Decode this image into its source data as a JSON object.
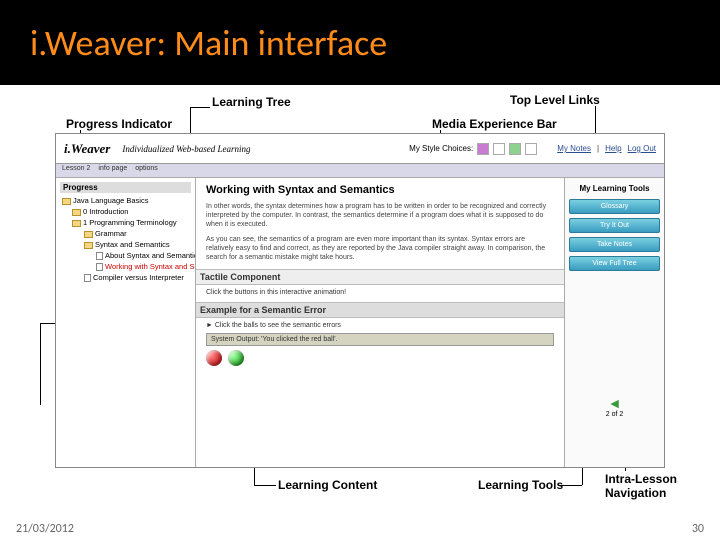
{
  "slide": {
    "title": "i.Weaver: Main interface",
    "date": "21/03/2012",
    "page": "30"
  },
  "callouts": {
    "progress": "Progress Indicator",
    "tree": "Learning Tree",
    "toplinks": "Top Level Links",
    "media": "Media Experience Bar",
    "tactile": "Tactile Component",
    "content": "Learning Content",
    "tools": "Learning Tools",
    "intranav": "Intra-Lesson Navigation"
  },
  "ss": {
    "logo": "i.Weaver",
    "tagline": "Individualized Web-based Learning",
    "styles_label": "My Style Choices:",
    "toplinks": {
      "notes": "My Notes",
      "help": "Help",
      "logout": "Log Out"
    },
    "nav": {
      "a": "Lesson 2",
      "b": "info page",
      "c": "options"
    },
    "tree": {
      "hdr": "Progress",
      "root": "Java Language Basics",
      "intro": "0 Introduction",
      "term": "1 Programming Terminology",
      "gram": "Grammar",
      "synsem": "Syntax and Semantics",
      "about": "About Syntax and Semantics",
      "work": "Working with Syntax and Semantics",
      "compint": "Compiler versus Interpreter"
    },
    "main": {
      "h1": "Working with Syntax and Semantics",
      "p1": "In other words, the syntax determines how a program has to be written in order to be recognized and correctly interpreted by the computer. In contrast, the semantics determine if a program does what it is supposed to do when it is executed.",
      "p2": "As you can see, the semantics of a program are even more important than its syntax. Syntax errors are relatively easy to find and correct, as they are reported by the Java compiler straight away. In comparison, the search for a semantic mistake might take hours.",
      "tactile_hdr": "Tactile Component",
      "tactile_instr": "Click the buttons in this interactive animation!",
      "example_hdr": "Example for a Semantic Error",
      "example_instr": "► Click the balls to see the semantic errors",
      "output": "System Output: 'You clicked the red ball'."
    },
    "tools": {
      "hdr": "My Learning Tools",
      "b1": "Glossary",
      "b2": "Try It Out",
      "b3": "Take Notes",
      "b4": "View Full Tree",
      "nav_counter": "2 of 2"
    }
  }
}
